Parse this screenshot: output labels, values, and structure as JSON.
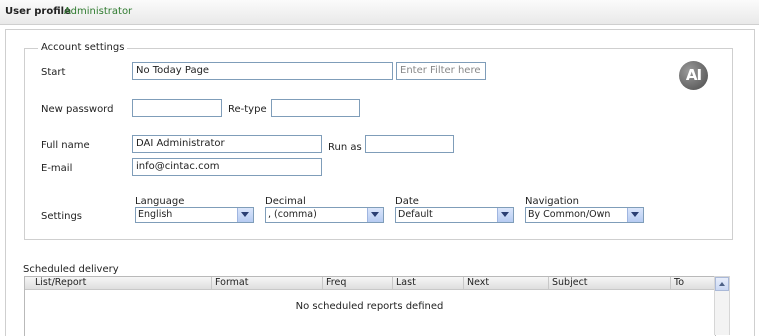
{
  "header": {
    "title": "User profile",
    "user": "Administrator"
  },
  "account": {
    "legend": "Account settings",
    "start_label": "Start",
    "start_value": "No Today Page",
    "filter_placeholder": "Enter Filter here",
    "new_password_label": "New password",
    "retype_label": "Re-type",
    "full_name_label": "Full name",
    "full_name_value": "DAI Administrator",
    "run_as_label": "Run as",
    "email_label": "E-mail",
    "email_value": "info@cintac.com",
    "settings_label": "Settings",
    "language_label": "Language",
    "language_value": "English",
    "decimal_label": "Decimal",
    "decimal_value": ", (comma)",
    "date_label": "Date",
    "date_value": "Default",
    "navigation_label": "Navigation",
    "navigation_value": "By Common/Own"
  },
  "logo_text": "AI",
  "scheduled": {
    "title": "Scheduled delivery",
    "columns": [
      "List/Report",
      "Format",
      "Freq",
      "Last",
      "Next",
      "Subject",
      "To"
    ],
    "empty_text": "No scheduled reports defined"
  }
}
